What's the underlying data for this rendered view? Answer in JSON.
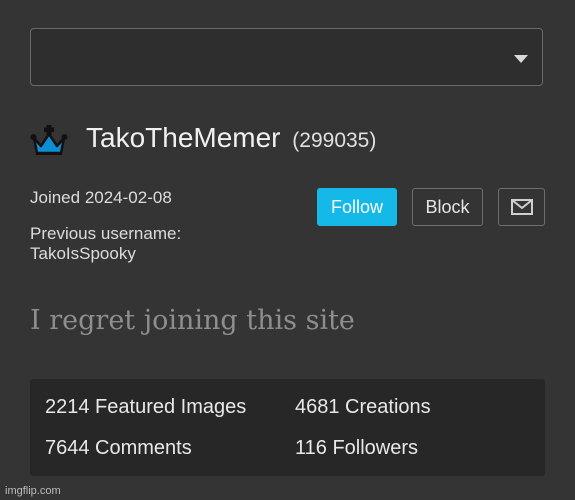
{
  "profile": {
    "username": "TakoTheMemer",
    "points": "(299035)",
    "joined": "Joined 2024-02-08",
    "previous_username_label": "Previous username:",
    "previous_username": "TakoIsSpooky",
    "bio": "I regret joining this site",
    "badge_icon": "crown-icon"
  },
  "actions": {
    "follow_label": "Follow",
    "block_label": "Block",
    "message_icon": "mail-icon"
  },
  "stats": {
    "featured": "2214 Featured Images",
    "creations": "4681 Creations",
    "comments": "7644 Comments",
    "followers": "116 Followers"
  },
  "dropdown": {
    "value": ""
  },
  "footer": {
    "watermark": "imgflip.com"
  },
  "colors": {
    "background": "#343434",
    "accent": "#14b9e8",
    "stats_panel": "#272727"
  }
}
